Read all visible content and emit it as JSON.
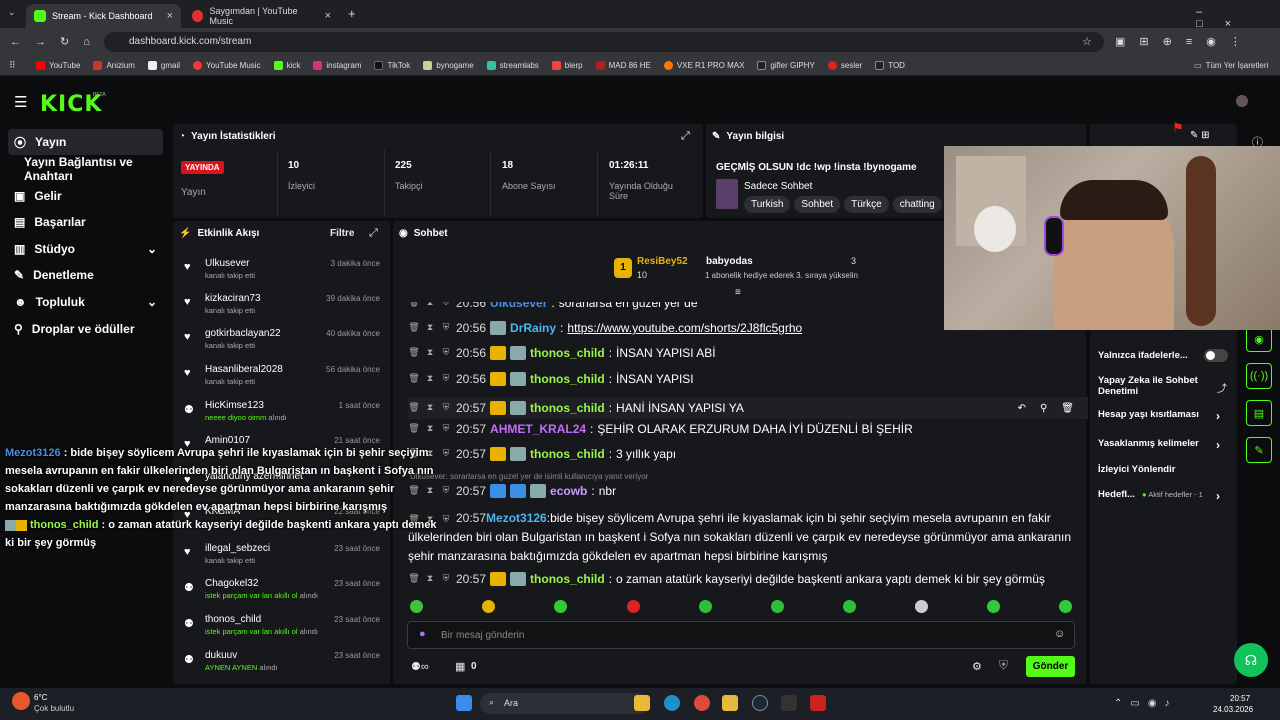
{
  "browser": {
    "tabs": [
      {
        "title": "Stream - Kick Dashboard"
      },
      {
        "title": "Saygımdan | YouTube Music"
      }
    ],
    "url": "dashboard.kick.com/stream",
    "bookmarks": [
      "YouTube",
      "Anizium",
      "gmail",
      "YouTube Music",
      "kick",
      "instagram",
      "TikTok",
      "bynogame",
      "streamlabs",
      "blerp",
      "MAD 86 HE",
      "VXE R1 PRO MAX",
      "gifler GIPHY",
      "sesler",
      "TOD"
    ],
    "all_bookmarks": "Tüm Yer İşaretleri"
  },
  "logo": "KICK",
  "logo_beta": "BETA",
  "sidebar": {
    "items": [
      {
        "label": "Yayın",
        "icon": "radio-icon"
      },
      {
        "label": "Yayın Bağlantısı ve Anahtarı"
      },
      {
        "label": "Gelir",
        "icon": "money-icon"
      },
      {
        "label": "Başarılar",
        "icon": "trophy-icon"
      },
      {
        "label": "Stüdyo",
        "icon": "studio-icon"
      },
      {
        "label": "Denetleme",
        "icon": "wrench-icon"
      },
      {
        "label": "Topluluk",
        "icon": "people-icon"
      },
      {
        "label": "Droplar ve ödüller",
        "icon": "gift-icon"
      }
    ]
  },
  "stats": {
    "title": "Yayın İstatistikleri",
    "live_badge": "YAYINDA",
    "live_label": "Yayın",
    "items": [
      {
        "value": "10",
        "label": "İzleyici"
      },
      {
        "value": "225",
        "label": "Takipçi"
      },
      {
        "value": "18",
        "label": "Abone Sayısı"
      },
      {
        "value": "01:26:11",
        "label": "Yayında Olduğu Süre"
      }
    ]
  },
  "info": {
    "title": "Yayın bilgisi",
    "stream_title": "GEÇMİŞ OLSUN !dc !wp !insta !bynogame",
    "category": "Sadece Sohbet",
    "tags": [
      "Turkish",
      "Sohbet",
      "Türkçe",
      "chatting"
    ]
  },
  "activity": {
    "title": "Etkinlik Akışı",
    "filter": "Filtre",
    "items": [
      {
        "name": "Ulkusever",
        "sub": "kanalı takip etti",
        "time": "3 dakika önce",
        "type": "follow"
      },
      {
        "name": "kizkaciran73",
        "sub": "kanalı takip etti",
        "time": "39 dakika önce",
        "type": "follow"
      },
      {
        "name": "gotkirbaclayan22",
        "sub": "kanalı takip etti",
        "time": "40 dakika önce",
        "type": "follow"
      },
      {
        "name": "Hasanliberal2028",
        "sub": "kanalı takip etti",
        "time": "56 dakika önce",
        "type": "follow"
      },
      {
        "name": "HicKimse123",
        "sub_green": "neeee diyoo oimm",
        "sub": "alındı",
        "time": "1 saat önce",
        "type": "reward"
      },
      {
        "name": "Amin0107",
        "sub": "",
        "time": "21 saat önce",
        "type": "follow"
      },
      {
        "name": "yalanduny azerminnet",
        "sub": "",
        "time": "",
        "type": "follow"
      },
      {
        "name": "KKBMA",
        "sub": "",
        "time": "22 saat önce",
        "type": "follow"
      },
      {
        "name": "illegal_sebzeci",
        "sub": "kanalı takip etti",
        "time": "23 saat önce",
        "type": "follow"
      },
      {
        "name": "Chagokel32",
        "sub_green": "istek parçam var lan akıllı ol",
        "sub": "alındı",
        "time": "23 saat önce",
        "type": "reward"
      },
      {
        "name": "thonos_child",
        "sub_green": "istek parçam var lan akıllı ol",
        "sub": "alındı",
        "time": "23 saat önce",
        "type": "reward"
      },
      {
        "name": "dukuuv",
        "sub_green": "AYNEN AYNEN",
        "sub": "alındı",
        "time": "23 saat önce",
        "type": "reward"
      }
    ]
  },
  "chat": {
    "title": "Sohbet",
    "pinned": {
      "user1": "ResiBey52",
      "user1_count": "10",
      "user2": "babyodas",
      "user2_count": "3",
      "user2_sub": "1 abonelik hediye ederek 3. sıraya yükselin"
    },
    "messages": [
      {
        "time": "20:56",
        "user": "Ulkusever",
        "text": "sorarlarsa en guzel yer de",
        "color": "#4a90e2"
      },
      {
        "time": "20:56",
        "user": "DrRainy",
        "text": "https://www.youtube.com/shorts/2J8flc5grho",
        "color": "#4ab7f0"
      },
      {
        "time": "20:56",
        "user": "thonos_child",
        "text": "İNSAN YAPISI ABİ",
        "color": "#9bf54a"
      },
      {
        "time": "20:56",
        "user": "thonos_child",
        "text": "İNSAN YAPISI",
        "color": "#9bf54a"
      },
      {
        "time": "20:57",
        "user": "thonos_child",
        "text": "HANİ İNSAN YAPISI YA",
        "color": "#9bf54a"
      },
      {
        "time": "20:57",
        "user": "AHMET_KRAL24",
        "text": "ŞEHİR OLARAK ERZURUM DAHA İYİ DÜZENLİ Bİ ŞEHİR",
        "color": "#c36cff"
      },
      {
        "time": "20:57",
        "user": "thonos_child",
        "text": "3 yıllık yapı",
        "color": "#9bf54a"
      },
      {
        "reply": "Ulkusever: sorarlarsa en guzel yer de isimli kullanıcıya yanıt veriyor"
      },
      {
        "time": "20:57",
        "user": "ecowb",
        "text": "nbr",
        "color": "#c79cff"
      },
      {
        "time": "20:57",
        "user": "Mezot3126",
        "text": "bide bişey söylicem Avrupa şehri ile kıyaslamak için bi şehir seçiyim mesela avrupanın en fakir ülkelerinden biri olan Bulgaristan ın başkent i Sofya nın sokakları düzenli ve çarpık ev neredeyse görünmüyor ama ankaranın şehir manzarasına baktığımızda gökdelen ev apartman hepsi birbirine karışmış",
        "color": "#4ab7f0"
      },
      {
        "time": "20:57",
        "user": "thonos_child",
        "text": "o zaman atatürk kayseriyi değilde başkenti ankara yaptı demek ki bir şey görmüş",
        "color": "#9bf54a"
      }
    ],
    "placeholder": "Bir mesaj gönderin",
    "send": "Gönder",
    "points": "0"
  },
  "right": {
    "rows": [
      "Yalnızca ifadelerle...",
      "Yapay Zeka ile Sohbet Denetimi",
      "Hesap yaşı kısıtlaması",
      "Yasaklanmış kelimeler",
      "İzleyici Yönlendir",
      "Hedefl...",
      "Aktif hedefler - 1"
    ]
  },
  "overlay": {
    "user1": "Mezot3126",
    "text1": "bide bişey söylicem Avrupa şehri ile kıyaslamak için bi şehir seçiyim mesela avrupanın en fakir ülkelerinden biri olan Bulgaristan ın başkent i Sofya nın sokakları düzenli ve çarpık ev neredeyse görünmüyor ama ankaranın şehir manzarasına baktığımızda gökdelen ev apartman hepsi birbirine karışmış",
    "user2": "thonos_child",
    "text2": "o zaman atatürk kayseriyi değilde başkenti ankara yaptı demek ki bir şey görmüş"
  },
  "taskbar": {
    "temp": "6°C",
    "weather": "Çok bulutlu",
    "search": "Ara",
    "time": "20:57",
    "date": "24.03.2026"
  }
}
